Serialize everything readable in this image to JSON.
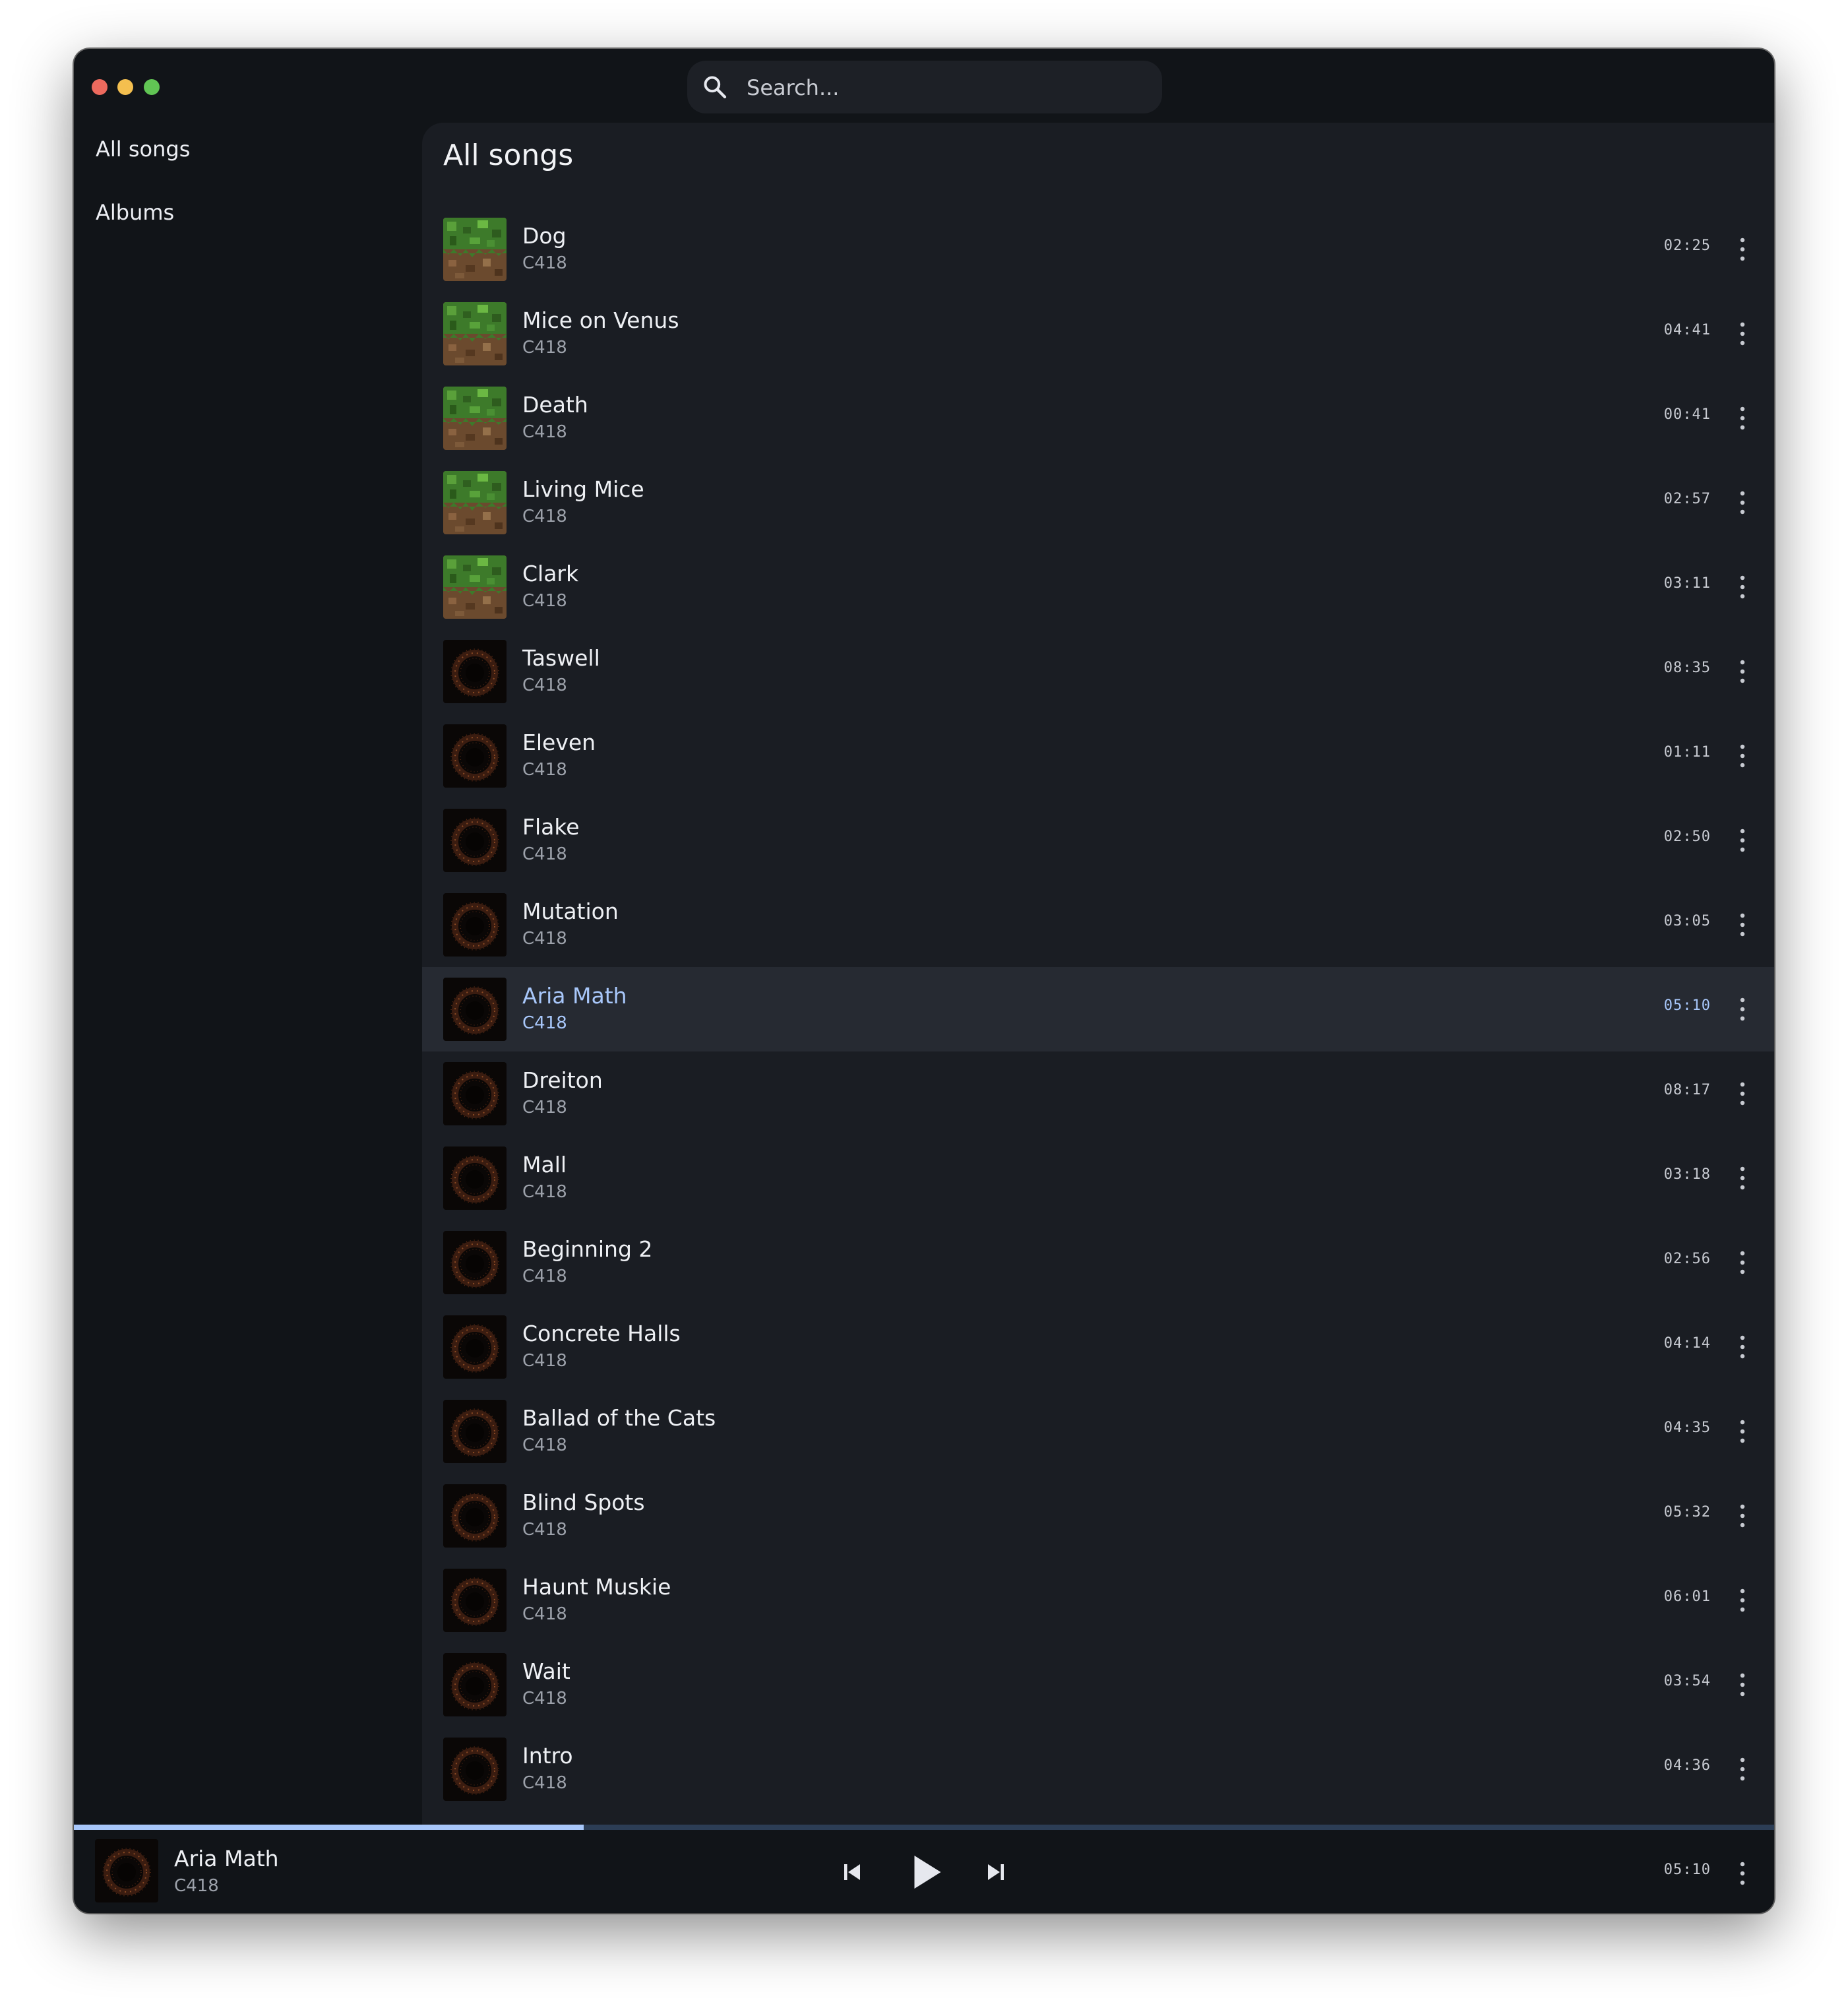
{
  "window": {
    "traffic_lights": {
      "close": "#ed6a5e",
      "minimize": "#f4bf4f",
      "zoom": "#61c554"
    }
  },
  "search": {
    "placeholder": "Search..."
  },
  "sidebar": {
    "items": [
      {
        "label": "All songs"
      },
      {
        "label": "Albums"
      }
    ]
  },
  "main": {
    "title": "All songs",
    "songs": [
      {
        "title": "Dog",
        "artist": "C418",
        "duration": "02:25",
        "album_art": "grass-block"
      },
      {
        "title": "Mice on Venus",
        "artist": "C418",
        "duration": "04:41",
        "album_art": "grass-block"
      },
      {
        "title": "Death",
        "artist": "C418",
        "duration": "00:41",
        "album_art": "grass-block"
      },
      {
        "title": "Living Mice",
        "artist": "C418",
        "duration": "02:57",
        "album_art": "grass-block"
      },
      {
        "title": "Clark",
        "artist": "C418",
        "duration": "03:11",
        "album_art": "grass-block"
      },
      {
        "title": "Taswell",
        "artist": "C418",
        "duration": "08:35",
        "album_art": "dark-ring"
      },
      {
        "title": "Eleven",
        "artist": "C418",
        "duration": "01:11",
        "album_art": "dark-ring"
      },
      {
        "title": "Flake",
        "artist": "C418",
        "duration": "02:50",
        "album_art": "dark-ring"
      },
      {
        "title": "Mutation",
        "artist": "C418",
        "duration": "03:05",
        "album_art": "dark-ring"
      },
      {
        "title": "Aria Math",
        "artist": "C418",
        "duration": "05:10",
        "album_art": "dark-ring",
        "active": true
      },
      {
        "title": "Dreiton",
        "artist": "C418",
        "duration": "08:17",
        "album_art": "dark-ring"
      },
      {
        "title": "Mall",
        "artist": "C418",
        "duration": "03:18",
        "album_art": "dark-ring"
      },
      {
        "title": "Beginning 2",
        "artist": "C418",
        "duration": "02:56",
        "album_art": "dark-ring"
      },
      {
        "title": "Concrete Halls",
        "artist": "C418",
        "duration": "04:14",
        "album_art": "dark-ring"
      },
      {
        "title": "Ballad of the Cats",
        "artist": "C418",
        "duration": "04:35",
        "album_art": "dark-ring"
      },
      {
        "title": "Blind Spots",
        "artist": "C418",
        "duration": "05:32",
        "album_art": "dark-ring"
      },
      {
        "title": "Haunt Muskie",
        "artist": "C418",
        "duration": "06:01",
        "album_art": "dark-ring"
      },
      {
        "title": "Wait",
        "artist": "C418",
        "duration": "03:54",
        "album_art": "dark-ring"
      },
      {
        "title": "Intro",
        "artist": "C418",
        "duration": "04:36",
        "album_art": "dark-ring"
      }
    ]
  },
  "player": {
    "title": "Aria Math",
    "artist": "C418",
    "duration": "05:10",
    "album_art": "dark-ring",
    "progress_fraction": 0.3,
    "controls": [
      "skip-previous-icon",
      "play-icon",
      "skip-next-icon"
    ]
  },
  "colors": {
    "accent": "#a8c7fa",
    "window_bg": "#111418",
    "panel_bg": "#1a1d23",
    "active_row_bg": "#262a32",
    "progress_track": "#2c3d55"
  }
}
